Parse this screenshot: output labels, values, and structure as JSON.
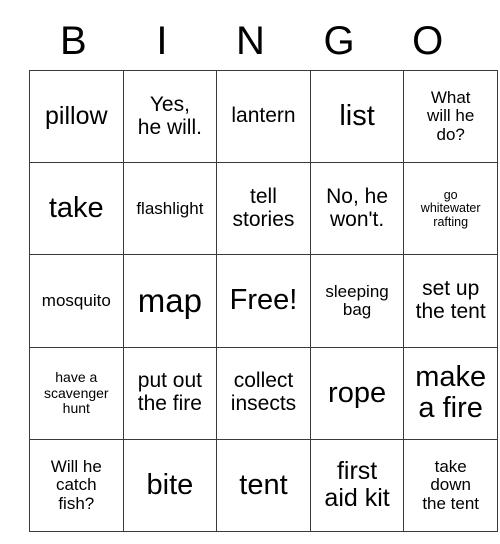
{
  "card": {
    "title": "BINGO",
    "headers": [
      {
        "letter": "B"
      },
      {
        "letter": "I"
      },
      {
        "letter": "N"
      },
      {
        "letter": "G"
      },
      {
        "letter": "O"
      }
    ],
    "free_space_label": "Free!",
    "border_color": "#3a3a3a",
    "text_color": "#000000",
    "background_color": "#ffffff",
    "rows": [
      [
        {
          "text": "pillow",
          "size": "l"
        },
        {
          "text": "Yes,\nhe will.",
          "size": "m"
        },
        {
          "text": "lantern",
          "size": "m"
        },
        {
          "text": "list",
          "size": "xl"
        },
        {
          "text": "What\nwill he\ndo?",
          "size": "s"
        }
      ],
      [
        {
          "text": "take",
          "size": "xl"
        },
        {
          "text": "flashlight",
          "size": "s"
        },
        {
          "text": "tell\nstories",
          "size": "m"
        },
        {
          "text": "No, he\nwon't.",
          "size": "m"
        },
        {
          "text": "go\nwhitewater\nrafting",
          "size": "xxs"
        }
      ],
      [
        {
          "text": "mosquito",
          "size": "s"
        },
        {
          "text": "map",
          "size": "xxl"
        },
        {
          "text": "Free!",
          "size": "xl"
        },
        {
          "text": "sleeping\nbag",
          "size": "s"
        },
        {
          "text": "set up\nthe tent",
          "size": "m"
        }
      ],
      [
        {
          "text": "have a\nscavenger\nhunt",
          "size": "xs"
        },
        {
          "text": "put out\nthe fire",
          "size": "m"
        },
        {
          "text": "collect\ninsects",
          "size": "m"
        },
        {
          "text": "rope",
          "size": "xl"
        },
        {
          "text": "make\na fire",
          "size": "xl"
        }
      ],
      [
        {
          "text": "Will he\ncatch\nfish?",
          "size": "s"
        },
        {
          "text": "bite",
          "size": "xl"
        },
        {
          "text": "tent",
          "size": "xl"
        },
        {
          "text": "first\naid kit",
          "size": "l"
        },
        {
          "text": "take\ndown\nthe tent",
          "size": "s"
        }
      ]
    ]
  }
}
